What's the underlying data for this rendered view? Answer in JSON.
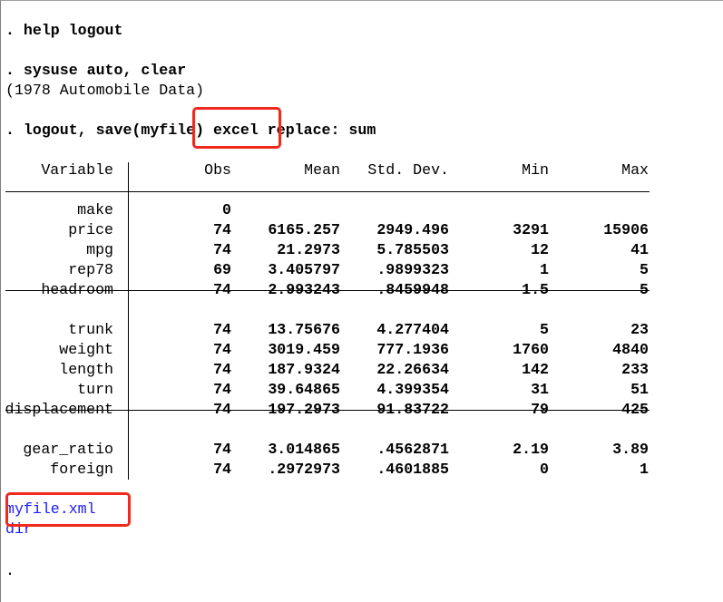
{
  "log": {
    "cmd1": ". help logout",
    "cmd2": ". sysuse auto, clear",
    "out2": "(1978 Automobile Data)",
    "cmd3": ". logout, save(myfile) excel replace: sum",
    "link1": "myfile.xml",
    "link2": "dir",
    "prompt": "."
  },
  "table": {
    "headers": [
      "Variable",
      "Obs",
      "Mean",
      "Std. Dev.",
      "Min",
      "Max"
    ],
    "groups": [
      [
        [
          "make",
          "0",
          "",
          "",
          "",
          ""
        ],
        [
          "price",
          "74",
          "6165.257",
          "2949.496",
          "3291",
          "15906"
        ],
        [
          "mpg",
          "74",
          "21.2973",
          "5.785503",
          "12",
          "41"
        ],
        [
          "rep78",
          "69",
          "3.405797",
          ".9899323",
          "1",
          "5"
        ],
        [
          "headroom",
          "74",
          "2.993243",
          ".8459948",
          "1.5",
          "5"
        ]
      ],
      [
        [
          "trunk",
          "74",
          "13.75676",
          "4.277404",
          "5",
          "23"
        ],
        [
          "weight",
          "74",
          "3019.459",
          "777.1936",
          "1760",
          "4840"
        ],
        [
          "length",
          "74",
          "187.9324",
          "22.26634",
          "142",
          "233"
        ],
        [
          "turn",
          "74",
          "39.64865",
          "4.399354",
          "31",
          "51"
        ],
        [
          "displacement",
          "74",
          "197.2973",
          "91.83722",
          "79",
          "425"
        ]
      ],
      [
        [
          "gear_ratio",
          "74",
          "3.014865",
          ".4562871",
          "2.19",
          "3.89"
        ],
        [
          "foreign",
          "74",
          ".2972973",
          ".4601885",
          "0",
          "1"
        ]
      ]
    ]
  },
  "colors": {
    "highlight": "#f0281e",
    "link": "#1a1aff"
  }
}
